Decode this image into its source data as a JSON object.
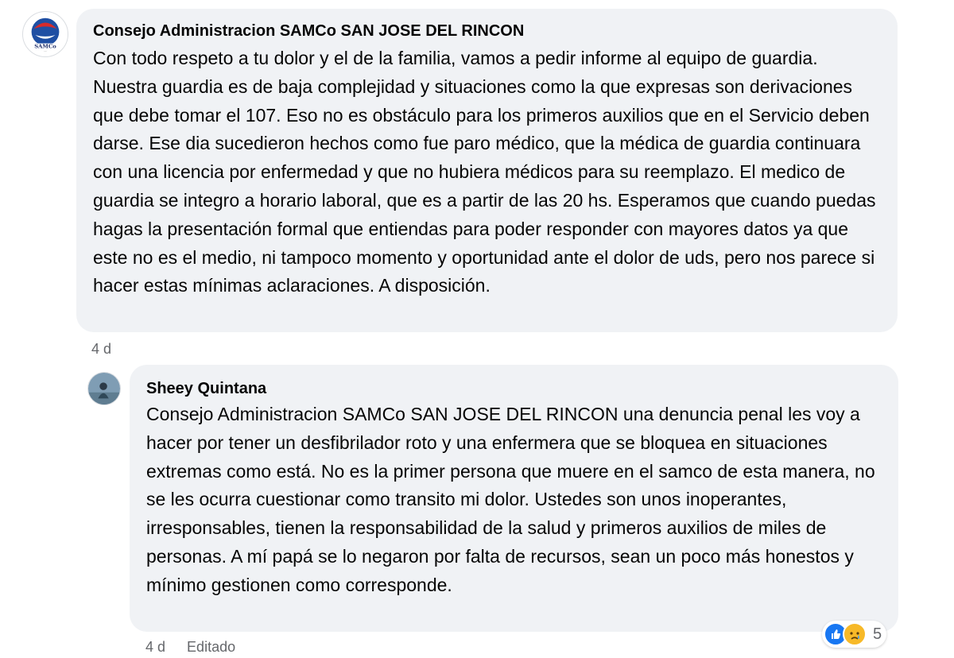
{
  "comments": [
    {
      "author": "Consejo Administracion SAMCo SAN JOSE DEL RINCON",
      "avatar_label": "SAMCo",
      "text": "Con todo respeto a tu dolor y el de la familia, vamos a pedir informe al equipo de guardia. Nuestra guardia es de baja complejidad y situaciones como la que expresas son derivaciones que debe tomar el 107. Eso no es obstáculo para los primeros auxilios que en el Servicio deben darse. Ese dia sucedieron hechos como fue paro médico, que la médica de guardia continuara con una licencia por enfermedad y que no hubiera médicos para su reemplazo. El medico de guardia se integro a horario laboral, que es a partir de las 20 hs. Esperamos que cuando puedas hagas la presentación formal que entiendas para poder responder con mayores datos ya que este no es el medio, ni tampoco momento y oportunidad ante el dolor de uds, pero nos parece si hacer estas mínimas aclaraciones. A disposición.",
      "time": "4 d"
    },
    {
      "author": "Sheey Quintana",
      "text": "Consejo Administracion SAMCo SAN JOSE DEL RINCON una denuncia penal les voy a hacer por tener un desfibrilador roto y una enfermera que se bloquea en situaciones extremas como está. No es la primer persona que muere en el samco de esta manera, no se les ocurra cuestionar como transito mi dolor. Ustedes son unos inoperantes, irresponsables, tienen la responsabilidad de la salud y primeros auxilios de miles de personas. A mí papá se lo negaron por falta de recursos, sean un poco más honestos y mínimo gestionen como corresponde.",
      "time": "4 d",
      "edited": "Editado",
      "reactions": {
        "icons": [
          "like-icon",
          "sad-icon"
        ],
        "count": "5"
      }
    }
  ],
  "colors": {
    "bubble": "#f0f2f5",
    "meta": "#65676b",
    "like": "#1877f2",
    "sad": "#f7b928"
  }
}
